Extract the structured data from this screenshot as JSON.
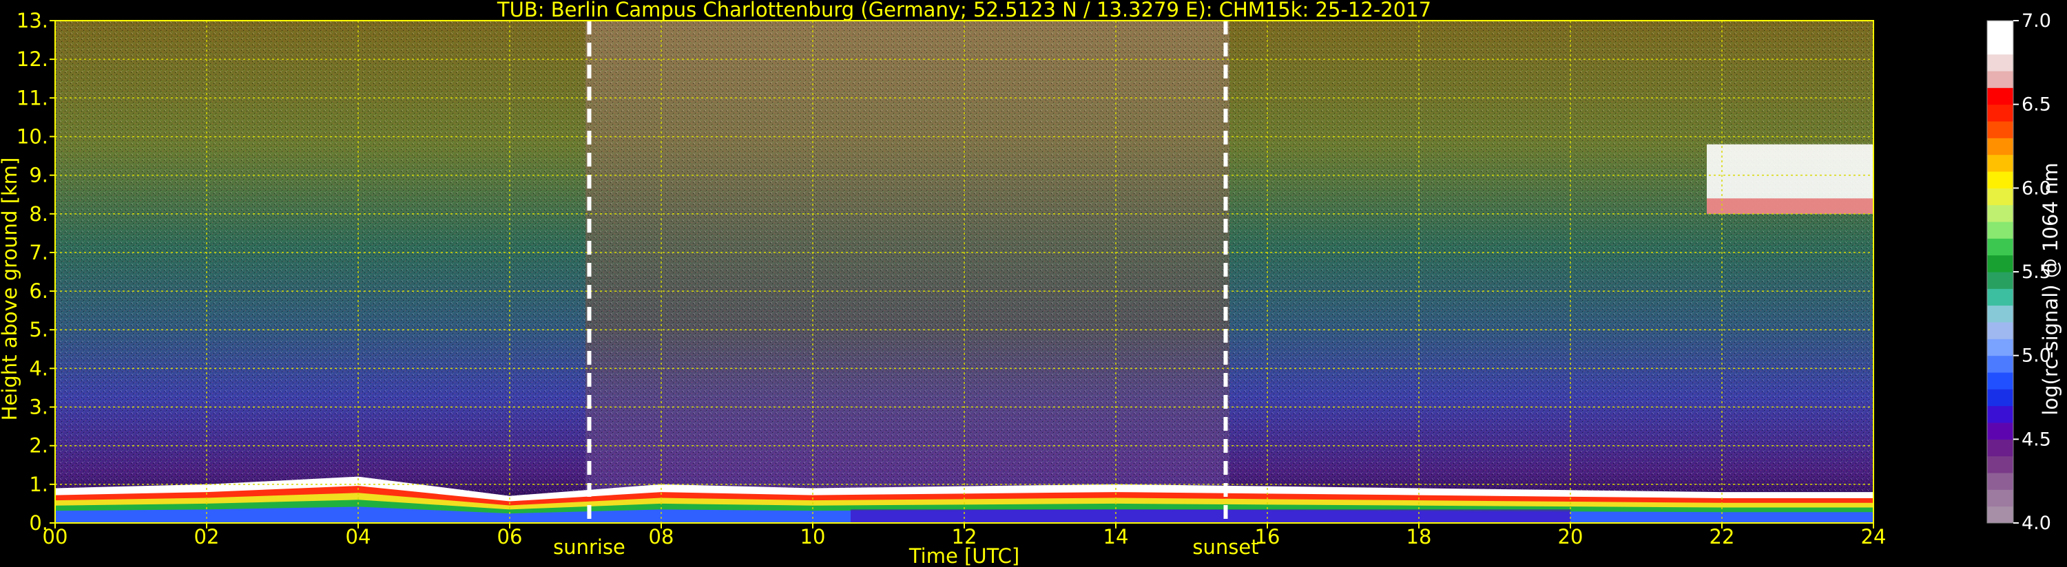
{
  "chart_data": {
    "type": "heatmap",
    "title": "TUB: Berlin Campus Charlottenburg (Germany; 52.5123 N / 13.3279 E):    CHM15k: 25-12-2017",
    "xlabel": "Time [UTC]",
    "ylabel": "Height above ground [km]",
    "xlim": [
      0,
      24
    ],
    "ylim": [
      0,
      13
    ],
    "x_ticks": [
      "00",
      "02",
      "04",
      "06",
      "08",
      "10",
      "12",
      "14",
      "16",
      "18",
      "20",
      "22",
      "24"
    ],
    "y_ticks": [
      "0.",
      "1.",
      "2.",
      "3.",
      "4.",
      "5.",
      "6.",
      "7.",
      "8.",
      "9.",
      "10.",
      "11.",
      "12.",
      "13."
    ],
    "grid": true,
    "colorbar": {
      "label": "log(rc-signal) @ 1064 nm",
      "range": [
        4.0,
        7.0
      ],
      "ticks": [
        "4.0",
        "4.5",
        "5.0",
        "5.5",
        "6.0",
        "6.5",
        "7.0"
      ],
      "colors": [
        "#a78fa7",
        "#9d7aa0",
        "#8e5f95",
        "#7a3a88",
        "#6a1f8a",
        "#5d06b0",
        "#3a10d4",
        "#1830e8",
        "#2050ff",
        "#4d7bff",
        "#7aa2ff",
        "#9fb8f0",
        "#88c9d8",
        "#3cbfa0",
        "#28a060",
        "#18a030",
        "#3cc850",
        "#88e870",
        "#c0f070",
        "#e8f040",
        "#fff000",
        "#ffc000",
        "#ff9000",
        "#ff5000",
        "#ff2000",
        "#ff0000",
        "#e8b0b0",
        "#f0d8d8",
        "#ffffff",
        "#ffffff"
      ]
    },
    "markers": [
      {
        "label": "sunrise",
        "x": 7.05
      },
      {
        "label": "sunset",
        "x": 15.45
      }
    ],
    "layers": [
      {
        "name": "boundary layer",
        "x": [
          0,
          2,
          4,
          6,
          8,
          10,
          12,
          14,
          16,
          18,
          20,
          22,
          24
        ],
        "top_km": [
          0.9,
          1.0,
          1.2,
          0.7,
          1.0,
          0.9,
          0.95,
          1.0,
          0.95,
          0.9,
          0.85,
          0.8,
          0.8
        ]
      },
      {
        "name": "high cloud",
        "x": [
          21.8,
          24
        ],
        "bottom_km": 8.0,
        "top_km": 9.8
      }
    ]
  }
}
